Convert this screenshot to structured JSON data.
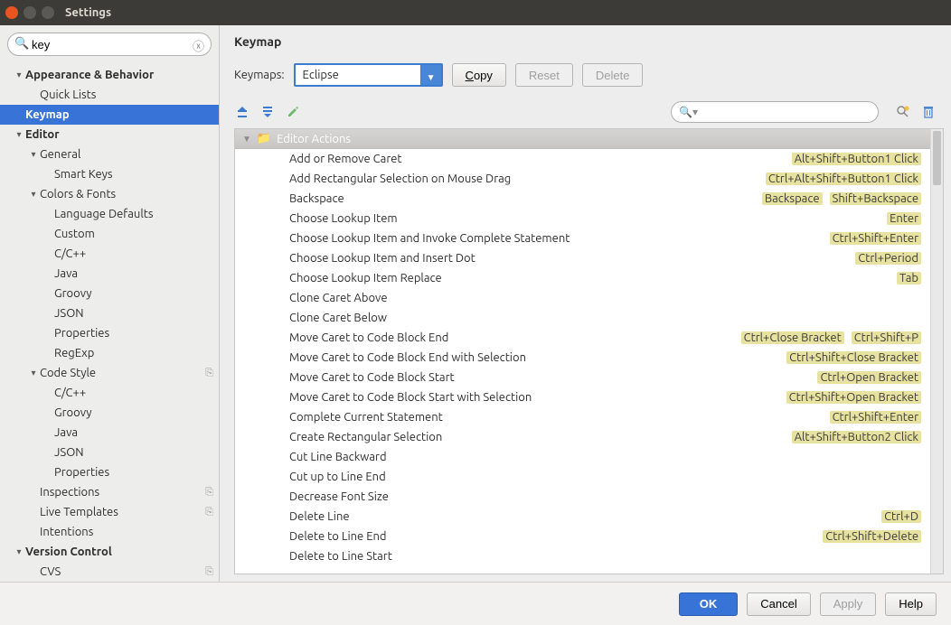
{
  "window": {
    "title": "Settings"
  },
  "sidebar": {
    "search_value": "key",
    "items": [
      {
        "label": "Appearance & Behavior",
        "indent": 0,
        "bold": true,
        "arrow": "▾"
      },
      {
        "label": "Quick Lists",
        "indent": 1
      },
      {
        "label": "Keymap",
        "indent": 0,
        "bold": true,
        "selected": true
      },
      {
        "label": "Editor",
        "indent": 0,
        "bold": true,
        "arrow": "▾"
      },
      {
        "label": "General",
        "indent": 1,
        "arrow": "▾"
      },
      {
        "label": "Smart Keys",
        "indent": 2
      },
      {
        "label": "Colors & Fonts",
        "indent": 1,
        "arrow": "▾"
      },
      {
        "label": "Language Defaults",
        "indent": 2
      },
      {
        "label": "Custom",
        "indent": 2
      },
      {
        "label": "C/C++",
        "indent": 2
      },
      {
        "label": "Java",
        "indent": 2
      },
      {
        "label": "Groovy",
        "indent": 2
      },
      {
        "label": "JSON",
        "indent": 2
      },
      {
        "label": "Properties",
        "indent": 2
      },
      {
        "label": "RegExp",
        "indent": 2
      },
      {
        "label": "Code Style",
        "indent": 1,
        "arrow": "▾",
        "glyph": "⎘"
      },
      {
        "label": "C/C++",
        "indent": 2
      },
      {
        "label": "Groovy",
        "indent": 2
      },
      {
        "label": "Java",
        "indent": 2
      },
      {
        "label": "JSON",
        "indent": 2
      },
      {
        "label": "Properties",
        "indent": 2
      },
      {
        "label": "Inspections",
        "indent": 1,
        "glyph": "⎘"
      },
      {
        "label": "Live Templates",
        "indent": 1,
        "glyph": "⎘"
      },
      {
        "label": "Intentions",
        "indent": 1
      },
      {
        "label": "Version Control",
        "indent": 0,
        "bold": true,
        "arrow": "▾"
      },
      {
        "label": "CVS",
        "indent": 1,
        "glyph": "⎘"
      }
    ]
  },
  "main": {
    "title": "Keymap",
    "keymaps_label": "Keymaps:",
    "keymap_selected": "Eclipse",
    "copy_label": "Copy",
    "reset_label": "Reset",
    "delete_label": "Delete",
    "group_header": "Editor Actions",
    "actions": [
      {
        "name": "Add or Remove Caret",
        "shortcuts": [
          "Alt+Shift+Button1 Click"
        ]
      },
      {
        "name": "Add Rectangular Selection on Mouse Drag",
        "shortcuts": [
          "Ctrl+Alt+Shift+Button1 Click"
        ]
      },
      {
        "name": "Backspace",
        "shortcuts": [
          "Backspace",
          "Shift+Backspace"
        ]
      },
      {
        "name": "Choose Lookup Item",
        "shortcuts": [
          "Enter"
        ]
      },
      {
        "name": "Choose Lookup Item and Invoke Complete Statement",
        "shortcuts": [
          "Ctrl+Shift+Enter"
        ]
      },
      {
        "name": "Choose Lookup Item and Insert Dot",
        "shortcuts": [
          "Ctrl+Period"
        ]
      },
      {
        "name": "Choose Lookup Item Replace",
        "shortcuts": [
          "Tab"
        ]
      },
      {
        "name": "Clone Caret Above",
        "shortcuts": []
      },
      {
        "name": "Clone Caret Below",
        "shortcuts": []
      },
      {
        "name": "Move Caret to Code Block End",
        "shortcuts": [
          "Ctrl+Close Bracket",
          "Ctrl+Shift+P"
        ]
      },
      {
        "name": "Move Caret to Code Block End with Selection",
        "shortcuts": [
          "Ctrl+Shift+Close Bracket"
        ]
      },
      {
        "name": "Move Caret to Code Block Start",
        "shortcuts": [
          "Ctrl+Open Bracket"
        ]
      },
      {
        "name": "Move Caret to Code Block Start with Selection",
        "shortcuts": [
          "Ctrl+Shift+Open Bracket"
        ]
      },
      {
        "name": "Complete Current Statement",
        "shortcuts": [
          "Ctrl+Shift+Enter"
        ]
      },
      {
        "name": "Create Rectangular Selection",
        "shortcuts": [
          "Alt+Shift+Button2 Click"
        ]
      },
      {
        "name": "Cut Line Backward",
        "shortcuts": []
      },
      {
        "name": "Cut up to Line End",
        "shortcuts": []
      },
      {
        "name": "Decrease Font Size",
        "shortcuts": []
      },
      {
        "name": "Delete Line",
        "shortcuts": [
          "Ctrl+D"
        ]
      },
      {
        "name": "Delete to Line End",
        "shortcuts": [
          "Ctrl+Shift+Delete"
        ]
      },
      {
        "name": "Delete to Line Start",
        "shortcuts": []
      }
    ]
  },
  "footer": {
    "ok": "OK",
    "cancel": "Cancel",
    "apply": "Apply",
    "help": "Help"
  }
}
